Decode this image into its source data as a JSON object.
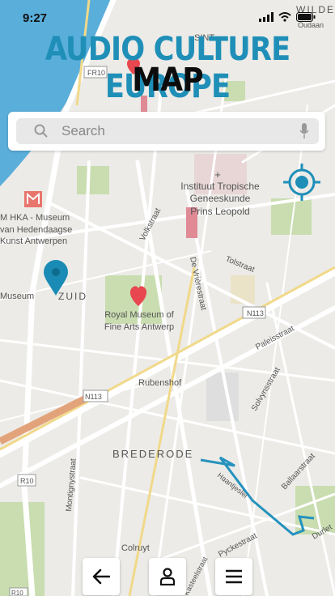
{
  "status": {
    "time": "9:27"
  },
  "header": {
    "title_line1": "AUDIO CULTURE EUROPE",
    "title_line2": "MAP"
  },
  "search": {
    "placeholder": "Search"
  },
  "map_labels": {
    "district_top": "SINT-\nANDRIES",
    "wilde": "WILDE",
    "oudaan": "Oudaan",
    "institute_1": "Instituut Tropische",
    "institute_2": "Geneeskunde",
    "institute_3": "Prins Leopold",
    "mhka_1": "M HKA - Museum",
    "mhka_2": "van Hedendaagse",
    "mhka_3": "Kunst Antwerpen",
    "museum": "Museum",
    "zuid": "ZUID",
    "royal_1": "Royal Museum of",
    "royal_2": "Fine Arts Antwerp",
    "rubenshof": "Rubenshof",
    "brederode": "BREDERODE",
    "colruyt": "Colruyt",
    "volkstraat": "Volkstraat",
    "devriere": "De Vrièrestraat",
    "tolstraat": "Tolstraat",
    "paleisstraat": "Paleisstraat",
    "solvynsstraat": "Solvynsstraat",
    "haantjeslei": "Haantjeslei",
    "ballaarstraat": "Ballaarstraat",
    "durlet": "Durlet",
    "pyckestraat": "Pyckestraat",
    "montigny": "Montignystraat",
    "kasteel": "Kasteelstraat",
    "n113a": "N113",
    "n113b": "N113",
    "r10a": "R10",
    "r10b": "R10",
    "fr10": "FR10"
  },
  "nav": {
    "back": "back",
    "profile": "profile",
    "menu": "menu"
  },
  "colors": {
    "accent": "#1f8fb8",
    "pin": "#1a8bb5",
    "heart": "#e8474f",
    "water": "#5aaeda"
  }
}
